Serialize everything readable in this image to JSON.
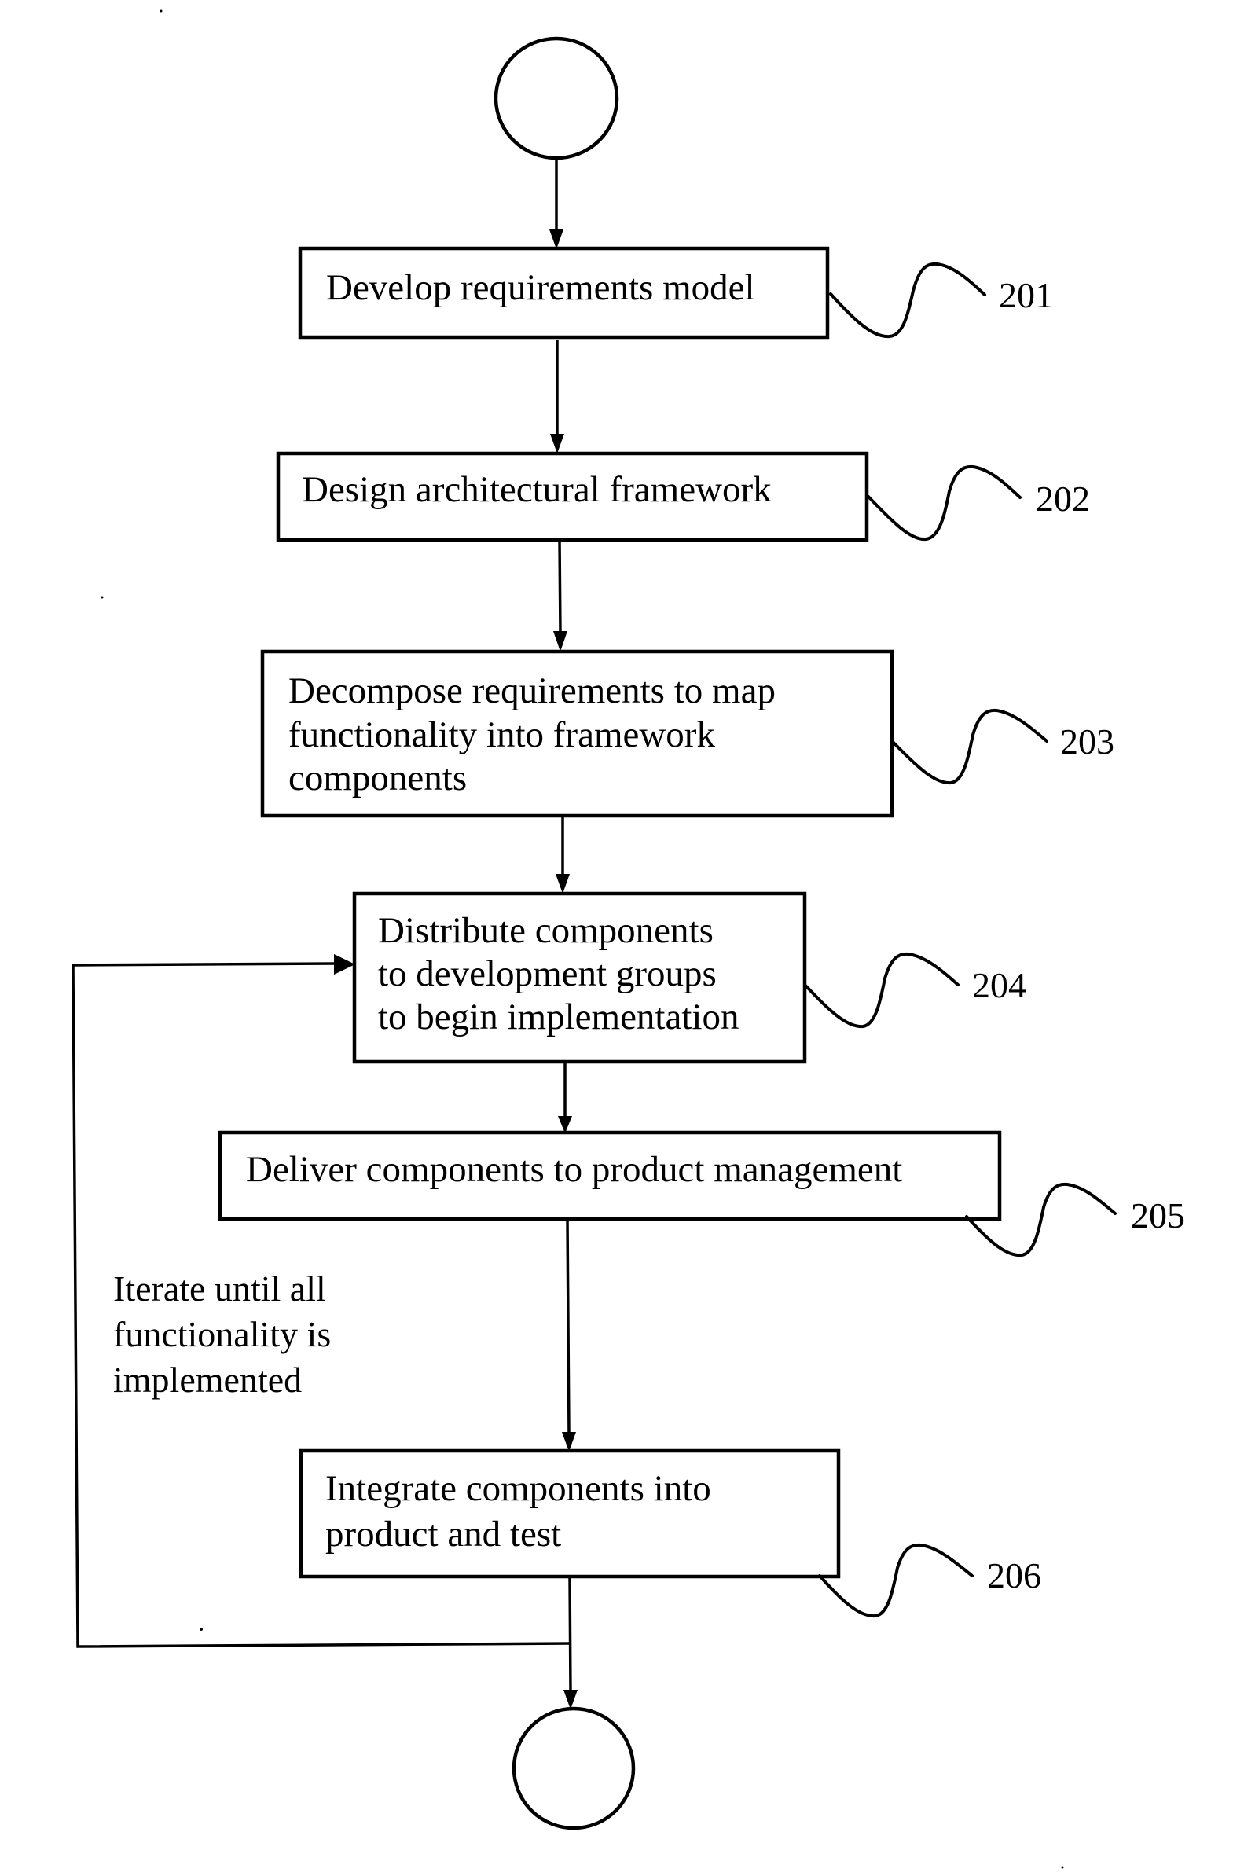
{
  "diagram": {
    "type": "flowchart",
    "start_terminal": {
      "label": ""
    },
    "end_terminal": {
      "label": ""
    },
    "steps": [
      {
        "ref": "201",
        "lines": [
          "Develop requirements model"
        ]
      },
      {
        "ref": "202",
        "lines": [
          "Design architectural framework"
        ]
      },
      {
        "ref": "203",
        "lines": [
          "Decompose requirements to map",
          "functionality into framework",
          "components"
        ]
      },
      {
        "ref": "204",
        "lines": [
          "Distribute components",
          "to development groups",
          "to begin implementation"
        ]
      },
      {
        "ref": "205",
        "lines": [
          "Deliver components to product management"
        ]
      },
      {
        "ref": "206",
        "lines": [
          "Integrate components into",
          "product and test"
        ]
      }
    ],
    "loop": {
      "from_ref": "206",
      "to_ref": "204",
      "note_lines": [
        "Iterate until all",
        "functionality is",
        "implemented"
      ]
    },
    "colors": {
      "ink": "#000000",
      "paper": "#ffffff"
    }
  }
}
